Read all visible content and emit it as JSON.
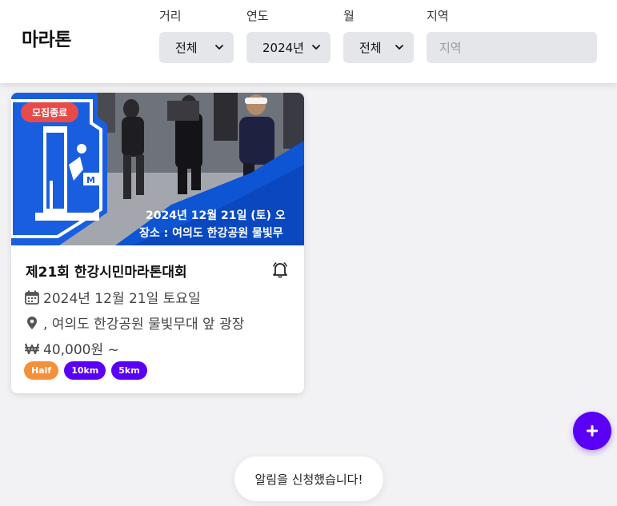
{
  "app": {
    "brand": "마라톤"
  },
  "filters": {
    "distance": {
      "label": "거리",
      "value": "전체"
    },
    "year": {
      "label": "연도",
      "value": "2024년"
    },
    "month": {
      "label": "월",
      "value": "전체"
    },
    "region": {
      "label": "지역",
      "placeholder": "지역"
    }
  },
  "events": [
    {
      "status": "모집종료",
      "title": "제21회 한강시민마라톤대회",
      "date": "2024년 12월 21일 토요일",
      "location": ", 여의도 한강공원 물빛무대 앞 광장",
      "price": "40,000원 ~",
      "banner_line1": "2024년 12월 21일 (토) 오",
      "banner_line2": "장소 : 여의도 한강공원 물빛무",
      "tags": [
        {
          "label": "Half",
          "color": "#f5903a"
        },
        {
          "label": "10km",
          "color": "#5a00f5"
        },
        {
          "label": "5km",
          "color": "#5a00f5"
        }
      ]
    }
  ],
  "toast": {
    "message": "알림을 신청했습니다!"
  },
  "colors": {
    "accent": "#5a00f5",
    "closed": "#e84a4a",
    "half": "#f5903a"
  },
  "icons": [
    "chevron-down-icon",
    "bell-icon",
    "calendar-icon",
    "map-pin-icon",
    "won-icon",
    "plus-icon"
  ]
}
